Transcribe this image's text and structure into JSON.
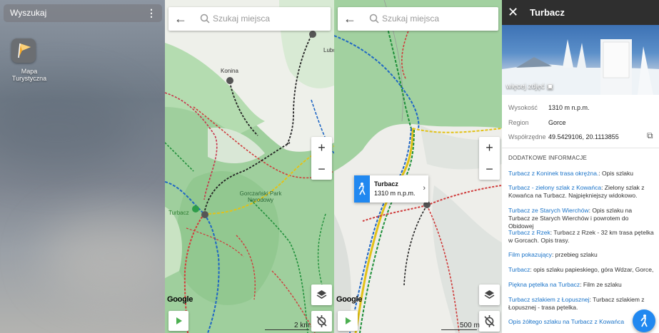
{
  "desktop": {
    "search_label": "Wyszukaj",
    "menu_icon": "more-vert-icon",
    "app_label": "Mapa Turystyczna"
  },
  "map1": {
    "search_placeholder": "Szukaj miejsca",
    "zoom_in": "+",
    "zoom_out": "−",
    "scale": "2 km",
    "labels": {
      "konina": "Konina",
      "lubo": "Lubo",
      "park": "Gorczański Park Narodowy",
      "turbacz": "Turbacz"
    },
    "google": "Google"
  },
  "map2": {
    "search_placeholder": "Szukaj miejsca",
    "zoom_in": "+",
    "zoom_out": "−",
    "scale": "500 m",
    "google": "Google",
    "popup": {
      "name": "Turbacz",
      "elevation": "1310 m n.p.m."
    }
  },
  "info": {
    "title": "Turbacz",
    "more_photos": "więcej zdjęć",
    "details": [
      {
        "key": "Wysokość",
        "value": "1310 m n.p.m."
      },
      {
        "key": "Region",
        "value": "Gorce"
      },
      {
        "key": "Współrzędne",
        "value": "49.5429106, 20.1113855"
      }
    ],
    "section_title": "DODATKOWE INFORMACJE",
    "items": [
      {
        "link": "Turbacz z Koninek trasa okrężna.",
        "text": ": Opis szlaku"
      },
      {
        "link": "Turbacz - zielony szlak z Kowańca",
        "text": ": Zielony szlak z Kowańca na Turbacz. Najpiękniejszy widokowo."
      },
      {
        "link": "Turbacz ze Starych Wierchów",
        "text": ": Opis szlaku na Turbacz ze Starych Wierchów i powrotem do Obidowej"
      },
      {
        "link": "Turbacz z Rzek",
        "text": ": Turbacz z Rzek - 32 km trasa pętelka w Gorcach. Opis trasy."
      },
      {
        "link": "Film pokazujący",
        "text": ": przebieg szlaku"
      },
      {
        "link": "Turbacz",
        "text": ": opis szlaku papieskiego, góra Wdzar, Gorce,"
      },
      {
        "link": "Piękna pętelka na Turbacz",
        "text": ": Film ze szlaku"
      },
      {
        "link": "Turbacz szlakiem z Łopusznej",
        "text": ": Turbacz szlakiem z Łopusznej - trasa pętelka."
      },
      {
        "link": "Opis żółtego szlaku na Turbacz z Kowańca",
        "text": ""
      }
    ]
  },
  "colors": {
    "accent": "#2188f0",
    "link": "#1a73c8",
    "header": "#2f2f2f",
    "play": "#4caf50"
  }
}
